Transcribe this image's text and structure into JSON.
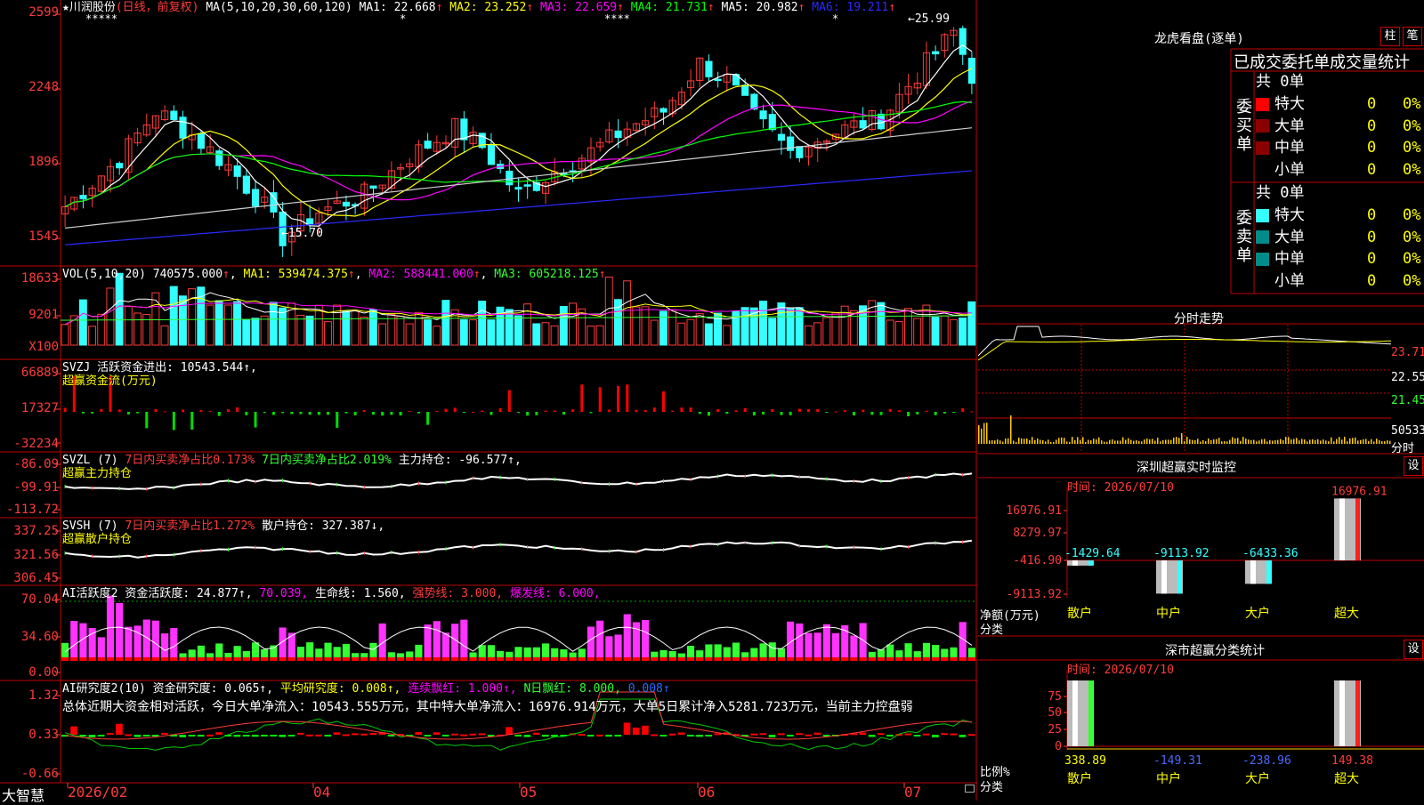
{
  "colors": {
    "up": "#ff3b3b",
    "down": "#33ffff",
    "ma1": "#ffffff",
    "ma2": "#ffff00",
    "ma3": "#ff00ff",
    "ma4": "#00ff00",
    "ma5": "#d0d0d0",
    "ma6": "#2a2aff",
    "vol_ma3": "#33ff33",
    "big_red": "#ff0000",
    "dark_red": "#8b0000",
    "teal": "#008b8b"
  },
  "main": {
    "title": "★川润股份",
    "mode": "(日线，前复权)",
    "ma_params": "MA(5,10,20,30,60,120)",
    "ma": [
      {
        "label": "MA1:",
        "value": "22.668",
        "arrow": "↑",
        "color": "#ffffff"
      },
      {
        "label": "MA2:",
        "value": "23.252",
        "arrow": "↑",
        "color": "#ffff00"
      },
      {
        "label": "MA3:",
        "value": "22.659",
        "arrow": "↑",
        "color": "#ff00ff"
      },
      {
        "label": "MA4:",
        "value": "21.731",
        "arrow": "↑",
        "color": "#00ff00"
      },
      {
        "label": "MA5:",
        "value": "20.982",
        "arrow": "↑",
        "color": "#ffffff"
      },
      {
        "label": "MA6:",
        "value": "19.211",
        "arrow": "↑",
        "color": "#2a2aff"
      }
    ],
    "y_ticks": [
      "2599",
      "2248",
      "1896",
      "1545"
    ],
    "high_mark": "25.99",
    "low_mark": "15.70",
    "star_marks": [
      "*****",
      "*",
      "****",
      "*"
    ]
  },
  "vol": {
    "header": "VOL(5,10,20)",
    "value": "740575.000",
    "ma1": "MA1: 539474.375",
    "ma2": "MA2: 588441.000",
    "ma3": "MA3: 605218.125",
    "y_ticks": [
      "18633",
      "9201",
      "X100"
    ]
  },
  "svzj": {
    "header": "SVZJ  活跃资金进出: 10543.544↑,",
    "sub": "超赢资金流(万元)",
    "y_ticks": [
      "66889",
      "17327",
      "-32234"
    ]
  },
  "svzl": {
    "header": "SVZL (7)",
    "a": "7日内买卖净占比0.173%",
    "b": "7日内买卖净占比2.019%",
    "c": "主力持仓: -96.577↑,",
    "sub": "超赢主力持仓",
    "y_ticks": [
      "-86.09",
      "-99.91",
      "-113.72"
    ]
  },
  "svsh": {
    "header": "SVSH (7)",
    "a": "7日内买卖净占比1.272%",
    "c": "散户持仓: 327.387↓,",
    "sub": "超赢散户持仓",
    "y_ticks": [
      "337.25",
      "321.56",
      "306.45"
    ]
  },
  "ai": {
    "header": "AI活跃度2",
    "a": "资金活跃度: 24.877↑,",
    "b": "70.039,",
    "c": "生命线: 1.560,",
    "d": "强势线: 3.000,",
    "e": "爆发线: 6.000,",
    "y_ticks": [
      "70.04",
      "34.60",
      "0.00"
    ]
  },
  "research": {
    "header": "AI研究度2(10)",
    "a": "资金研究度: 0.065↑,",
    "b": "平均研究度: 0.008↑,",
    "c": "连续飘红: 1.000↑,",
    "d": "N日飘红: 8.000,",
    "e": "0.008↑",
    "summary": "总体近期大资金相对活跃，今日大单净流入：10543.555万元，其中特大单净流入：16976.914万元，大单5日累计净入5281.723万元，当前主力控盘弱",
    "y_ticks": [
      "1.32",
      "0.33",
      "-0.66"
    ]
  },
  "bottom": {
    "brand": "大智慧",
    "dates": [
      "2026/02",
      "04",
      "05",
      "06",
      "07"
    ]
  },
  "right": {
    "dragon_title": "龙虎看盘(逐单)",
    "btn_zhu": "柱",
    "btn_bi": "笔",
    "table_title": "已成交委托单成交量统计",
    "buy_label": "委买单",
    "sell_label": "委卖单",
    "buy_count": "共 0单",
    "sell_count": "共 0单",
    "buy_rows": [
      {
        "name": "特大",
        "val": "0",
        "pct": "0%",
        "color": "#ff0000"
      },
      {
        "name": "大单",
        "val": "0",
        "pct": "0%",
        "color": "#8b0000"
      },
      {
        "name": "中单",
        "val": "0",
        "pct": "0%",
        "color": "#8b0000"
      },
      {
        "name": "小单",
        "val": "0",
        "pct": "0%",
        "color": ""
      }
    ],
    "sell_rows": [
      {
        "name": "特大",
        "val": "0",
        "pct": "0%",
        "color": "#33ffff"
      },
      {
        "name": "大单",
        "val": "0",
        "pct": "0%",
        "color": "#008b8b"
      },
      {
        "name": "中单",
        "val": "0",
        "pct": "0%",
        "color": "#008b8b"
      },
      {
        "name": "小单",
        "val": "0",
        "pct": "0%",
        "color": ""
      }
    ],
    "fenshi_title": "分时走势",
    "fenshi_ticks": [
      "23.71",
      "22.55",
      "21.45",
      "50533",
      "分时"
    ],
    "monitor_title": "深圳超赢实时监控",
    "monitor_btn": "设",
    "monitor_time": "时间: 2026/07/10",
    "monitor_y": [
      "16976.91",
      "8279.97",
      "-416.90",
      "-9113.92"
    ],
    "monitor_bars": [
      {
        "cat": "散户",
        "val": "-1429.64"
      },
      {
        "cat": "中户",
        "val": "-9113.92"
      },
      {
        "cat": "大户",
        "val": "-6433.36"
      },
      {
        "cat": "超大",
        "val": "16976.91"
      }
    ],
    "monitor_axis1": "净额(万元)",
    "monitor_axis2": "分类",
    "stat_title": "深市超赢分类统计",
    "stat_btn": "设",
    "stat_time": "时间: 2026/07/10",
    "stat_y": [
      "75",
      "50",
      "25",
      "0"
    ],
    "stat_bars": [
      {
        "cat": "散户",
        "val": "338.89"
      },
      {
        "cat": "中户",
        "val": "-149.31"
      },
      {
        "cat": "大户",
        "val": "-238.96"
      },
      {
        "cat": "超大",
        "val": "149.38"
      }
    ],
    "stat_axis1": "比例%",
    "stat_axis2": "分类"
  }
}
